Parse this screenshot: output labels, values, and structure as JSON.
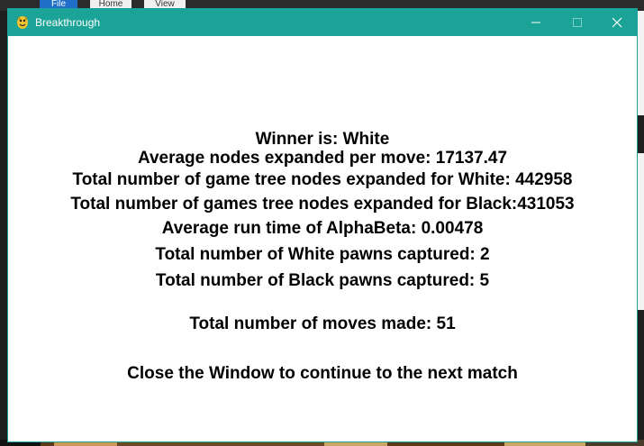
{
  "background": {
    "tabs": [
      "File",
      "Home",
      "View"
    ]
  },
  "window": {
    "title": "Breakthrough",
    "controls": {
      "minimize": "minimize-icon",
      "maximize": "maximize-icon",
      "close": "close-icon"
    }
  },
  "results": {
    "winner": "Winner is: White",
    "avg_nodes": "Average nodes expanded per move: 17137.47",
    "total_white": "Total number of game tree nodes expanded for White: 442958",
    "total_black": "Total number of games tree nodes expanded for Black:431053",
    "avg_runtime": "Average run time of AlphaBeta: 0.00478",
    "white_captured": "Total number of White pawns captured: 2",
    "black_captured": "Total number of Black pawns captured: 5",
    "moves_made": "Total number of moves made: 51",
    "instruction": "Close the Window to continue to the next match"
  },
  "colors": {
    "titlebar": "#1aa396",
    "text": "#000000"
  }
}
